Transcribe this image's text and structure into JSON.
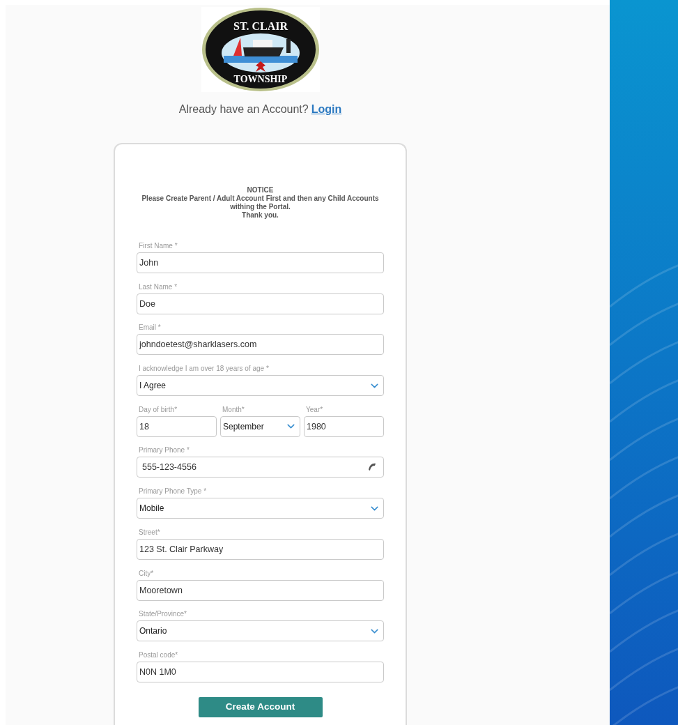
{
  "logo": {
    "top_text": "ST. CLAIR",
    "bottom_text": "TOWNSHIP"
  },
  "login_prompt": {
    "text": "Already have an Account?",
    "link": "Login"
  },
  "notice": {
    "title": "NOTICE",
    "lines": [
      "Please Create Parent / Adult Account First and then any Child Accounts withing the Portal.",
      "Thank you."
    ]
  },
  "fields": [
    {
      "kind": "text",
      "label": "First Name *",
      "value": "John"
    },
    {
      "kind": "text",
      "label": "Last Name *",
      "value": "Doe"
    },
    {
      "kind": "text",
      "label": "Email *",
      "value": "johndoetest@sharklasers.com"
    },
    {
      "kind": "select",
      "label": "I acknowledge I am over 18 years of age *",
      "value": "I Agree"
    },
    {
      "kind": "row",
      "items": [
        {
          "kind": "text",
          "label": "Day of birth*",
          "value": "18"
        },
        {
          "kind": "select",
          "label": "Month*",
          "value": "September"
        },
        {
          "kind": "text",
          "label": "Year*",
          "value": "1980"
        }
      ]
    },
    {
      "kind": "phone",
      "label": "Primary Phone *",
      "value": "555-123-4556"
    },
    {
      "kind": "select",
      "label": "Primary Phone Type *",
      "value": "Mobile"
    },
    {
      "kind": "text",
      "label": "Street*",
      "value": "123 St. Clair Parkway"
    },
    {
      "kind": "text",
      "label": "City*",
      "value": "Mooretown"
    },
    {
      "kind": "select",
      "label": "State/Province*",
      "value": "Ontario"
    },
    {
      "kind": "text",
      "label": "Postal code*",
      "value": "N0N 1M0"
    }
  ],
  "submit": "Create Account"
}
